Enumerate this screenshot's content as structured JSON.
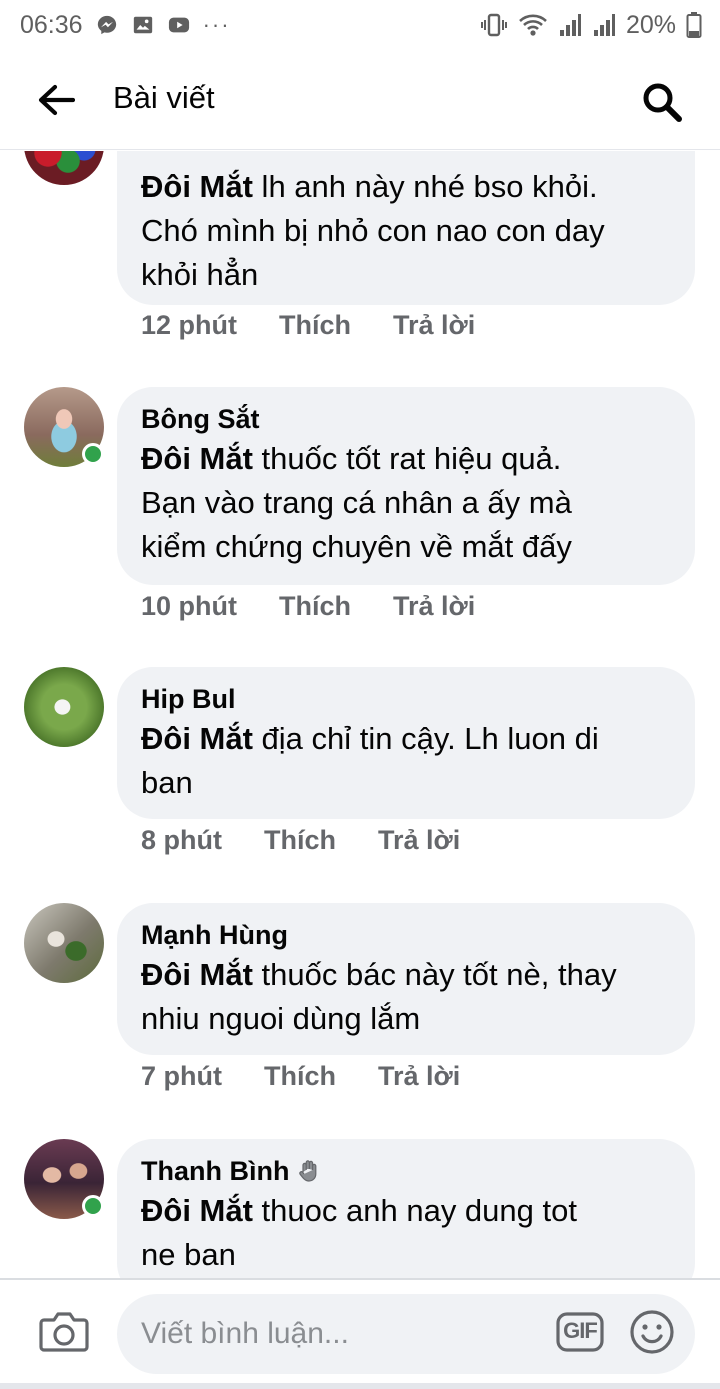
{
  "status_bar": {
    "time": "06:36",
    "battery": "20%",
    "left_icons": [
      "messenger-icon",
      "gallery-icon",
      "youtube-icon",
      "more-icon"
    ],
    "right_icons": [
      "vibrate-icon",
      "wifi-icon",
      "signal-icon",
      "signal-icon",
      "battery-icon"
    ]
  },
  "header": {
    "title": "Bài viết",
    "back_icon": "arrow-left-icon",
    "search_icon": "search-icon"
  },
  "comments": [
    {
      "author": "",
      "mention": "Đôi Mắt",
      "text_lines": [
        " lh anh này nhé bso khỏi.",
        "Chó mình bị nhỏ con nao con day",
        "khỏi hẳn"
      ],
      "time": "12 phút",
      "like": "Thích",
      "reply": "Trả lời",
      "online": false
    },
    {
      "author": "Bông Sắt",
      "mention": "Đôi Mắt",
      "text_lines": [
        " thuốc tốt rat hiệu quả.",
        "Bạn vào trang cá nhân a ấy mà",
        "kiểm chứng chuyên về mắt đấy"
      ],
      "time": "10 phút",
      "like": "Thích",
      "reply": "Trả lời",
      "online": true
    },
    {
      "author": "Hip Bul",
      "mention": "Đôi Mắt",
      "text_lines": [
        " địa chỉ tin cậy. Lh luon di",
        "ban"
      ],
      "time": "8 phút",
      "like": "Thích",
      "reply": "Trả lời",
      "online": false
    },
    {
      "author": "Mạnh Hùng",
      "mention": "Đôi Mắt",
      "text_lines": [
        " thuốc bác này tốt nè, thay",
        "nhiu nguoi dùng lắm"
      ],
      "time": "7 phút",
      "like": "Thích",
      "reply": "Trả lời",
      "online": false
    },
    {
      "author": "Thanh Bình",
      "author_badge": "wave-hand-icon",
      "mention": "Đôi Mắt",
      "text_lines": [
        " thuoc anh nay dung tot",
        "ne ban"
      ],
      "time": "",
      "like": "",
      "reply": "",
      "online": true
    }
  ],
  "composer": {
    "placeholder": "Viết bình luận...",
    "camera_icon": "camera-icon",
    "gif_label": "GIF",
    "emoji_icon": "emoji-icon"
  },
  "colors": {
    "bubble": "#f0f2f5",
    "meta_text": "#65676b",
    "online": "#31a24c",
    "text": "#050505"
  }
}
